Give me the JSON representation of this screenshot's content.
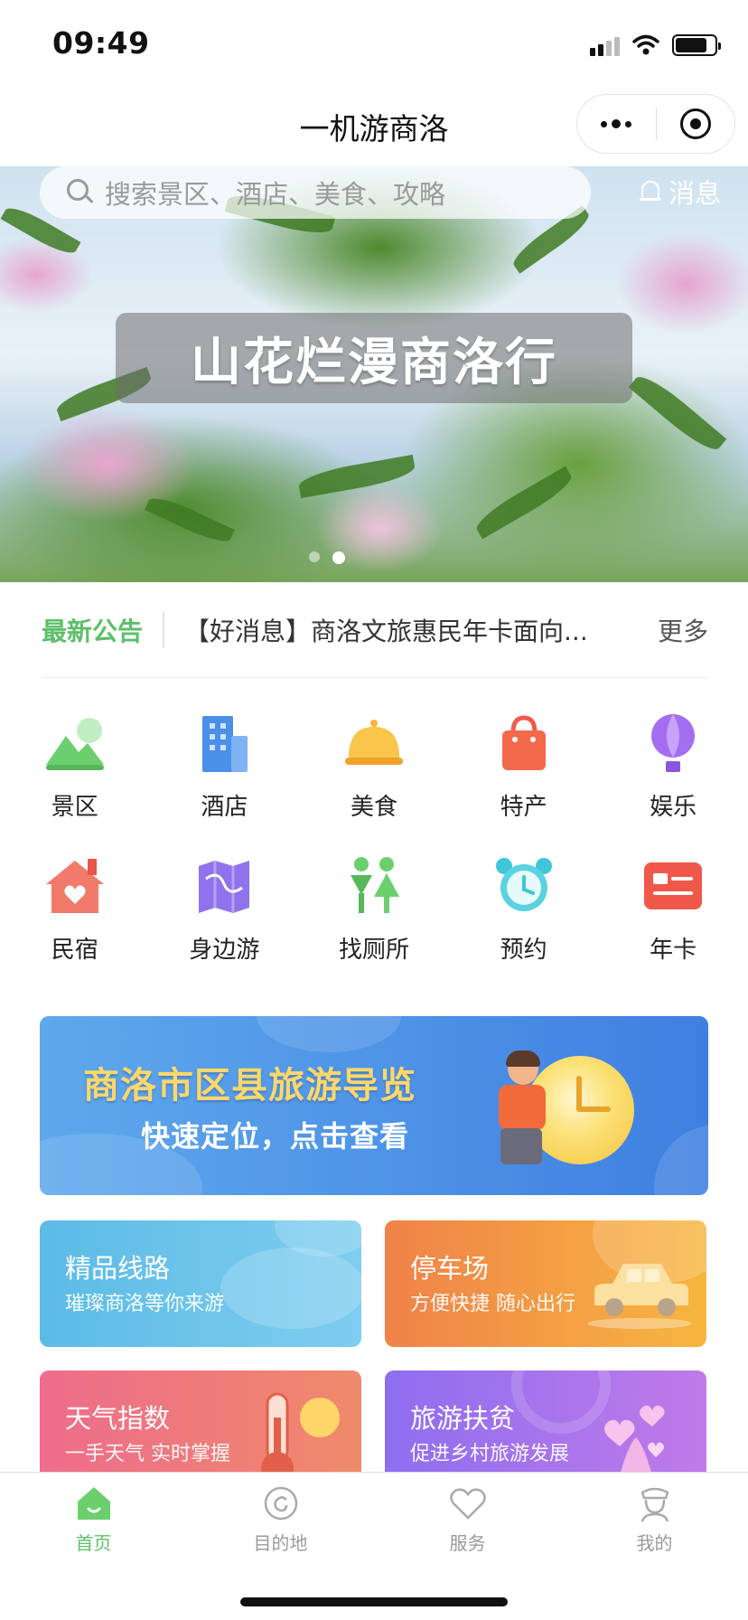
{
  "status_bar": {
    "time": "09:49"
  },
  "nav": {
    "title": "一机游商洛"
  },
  "banner": {
    "search_placeholder": "搜索景区、酒店、美食、攻略",
    "message_label": "消息",
    "title": "山花烂漫商洛行",
    "slide_count": 2,
    "active_slide": 2
  },
  "notice": {
    "label": "最新公告",
    "text": "【好消息】商洛文旅惠民年卡面向...",
    "more": "更多"
  },
  "categories": [
    {
      "label": "景区",
      "icon": "mountain-icon",
      "color": "#6ccf6e"
    },
    {
      "label": "酒店",
      "icon": "building-icon",
      "color": "#4a8fe8"
    },
    {
      "label": "美食",
      "icon": "cloche-icon",
      "color": "#f6b43a"
    },
    {
      "label": "特产",
      "icon": "shopping-bag-icon",
      "color": "#f05a4a"
    },
    {
      "label": "娱乐",
      "icon": "hot-air-balloon-icon",
      "color": "#a46ef0"
    },
    {
      "label": "民宿",
      "icon": "house-heart-icon",
      "color": "#f26a6a"
    },
    {
      "label": "身边游",
      "icon": "map-icon",
      "color": "#8f72ec"
    },
    {
      "label": "找厕所",
      "icon": "restroom-icon",
      "color": "#6ccf6e"
    },
    {
      "label": "预约",
      "icon": "alarm-clock-icon",
      "color": "#3fc6d8"
    },
    {
      "label": "年卡",
      "icon": "card-icon",
      "color": "#f0584a"
    }
  ],
  "guide": {
    "title": "商洛市区县旅游导览",
    "subtitle": "快速定位，点击查看"
  },
  "cards": {
    "route": {
      "title": "精品线路",
      "subtitle": "璀璨商洛等你来游"
    },
    "parking": {
      "title": "停车场",
      "subtitle": "方便快捷 随心出行"
    },
    "weather": {
      "title": "天气指数",
      "subtitle": "一手天气 实时掌握"
    },
    "poverty": {
      "title": "旅游扶贫",
      "subtitle": "促进乡村旅游发展"
    }
  },
  "tabs": [
    {
      "label": "首页",
      "icon": "home-icon",
      "active": true
    },
    {
      "label": "目的地",
      "icon": "destination-icon",
      "active": false
    },
    {
      "label": "服务",
      "icon": "heart-hand-icon",
      "active": false
    },
    {
      "label": "我的",
      "icon": "user-icon",
      "active": false
    }
  ],
  "colors": {
    "accent": "#5cbf6a",
    "tab_inactive": "#9a9a9a"
  }
}
